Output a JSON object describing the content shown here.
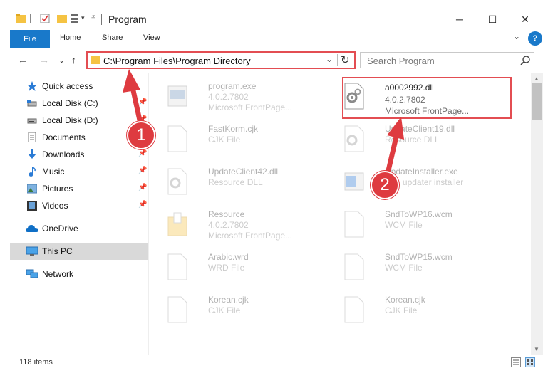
{
  "window": {
    "title": "Program",
    "minimize_glyph": "─",
    "maximize_glyph": "☐",
    "close_glyph": "✕"
  },
  "ribbon": {
    "tabs": [
      "File",
      "Home",
      "Share",
      "View"
    ],
    "help_glyph": "?",
    "expand_glyph": "⌄"
  },
  "address": {
    "path": "C:\\Program Files\\Program Directory",
    "chevron": "⌄",
    "refresh_glyph": "↻",
    "back_glyph": "←",
    "forward_glyph": "→",
    "recent_glyph": "⌄",
    "up_glyph": "↑"
  },
  "search": {
    "placeholder": "Search Program"
  },
  "sidebar": {
    "items": [
      {
        "label": "Quick access",
        "icon": "star-icon",
        "pinned": false
      },
      {
        "label": "Local Disk (C:)",
        "icon": "drive-icon",
        "pinned": true
      },
      {
        "label": "Local Disk (D:)",
        "icon": "drive-icon",
        "pinned": true
      },
      {
        "label": "Documents",
        "icon": "documents-icon",
        "pinned": true
      },
      {
        "label": "Downloads",
        "icon": "download-icon",
        "pinned": true
      },
      {
        "label": "Music",
        "icon": "music-icon",
        "pinned": true
      },
      {
        "label": "Pictures",
        "icon": "pictures-icon",
        "pinned": true
      },
      {
        "label": "Videos",
        "icon": "videos-icon",
        "pinned": true
      },
      {
        "label": "OneDrive",
        "icon": "cloud-icon",
        "pinned": false
      },
      {
        "label": "This PC",
        "icon": "computer-icon",
        "pinned": false,
        "selected": true
      },
      {
        "label": "Network",
        "icon": "network-icon",
        "pinned": false
      }
    ],
    "pin_glyph": "📌"
  },
  "files": [
    {
      "name": "program.exe",
      "line2": "4.0.2.7802",
      "line3": "Microsoft FrontPage...",
      "icon": "exe-icon",
      "faded": true
    },
    {
      "name": "a0002992.dll",
      "line2": "4.0.2.7802",
      "line3": "Microsoft FrontPage...",
      "icon": "dll-gear-icon",
      "faded": false,
      "highlighted": true
    },
    {
      "name": "FastKorm.cjk",
      "line2": "CJK File",
      "line3": "",
      "icon": "blank-file-icon",
      "faded": true
    },
    {
      "name": "UpdateClient19.dll",
      "line2": "Resource DLL",
      "line3": "",
      "icon": "dll-gear-icon",
      "faded": true
    },
    {
      "name": "UpdateClient42.dll",
      "line2": "Resource DLL",
      "line3": "",
      "icon": "dll-gear-icon",
      "faded": true
    },
    {
      "name": "UpdateInstaller.exe",
      "line2": "DLL updater installer",
      "line3": "",
      "icon": "installer-icon",
      "faded": true
    },
    {
      "name": "Resource",
      "line2": "4.0.2.7802",
      "line3": "Microsoft FrontPage...",
      "icon": "folder-file-icon",
      "faded": true
    },
    {
      "name": "SndToWP16.wcm",
      "line2": "WCM File",
      "line3": "",
      "icon": "blank-file-icon",
      "faded": true
    },
    {
      "name": "Arabic.wrd",
      "line2": "WRD File",
      "line3": "",
      "icon": "blank-file-icon",
      "faded": true
    },
    {
      "name": "SndToWP15.wcm",
      "line2": "WCM File",
      "line3": "",
      "icon": "blank-file-icon",
      "faded": true
    },
    {
      "name": "Korean.cjk",
      "line2": "CJK File",
      "line3": "",
      "icon": "blank-file-icon",
      "faded": true
    },
    {
      "name": "Korean.cjk",
      "line2": "CJK File",
      "line3": "",
      "icon": "blank-file-icon",
      "faded": true
    }
  ],
  "status": {
    "item_count": "118 items"
  },
  "annotations": {
    "step1": "1",
    "step2": "2"
  },
  "colors": {
    "accent": "#1979ca",
    "highlight": "#e34d52",
    "badge": "#de3b40",
    "folder": "#f5c343"
  }
}
